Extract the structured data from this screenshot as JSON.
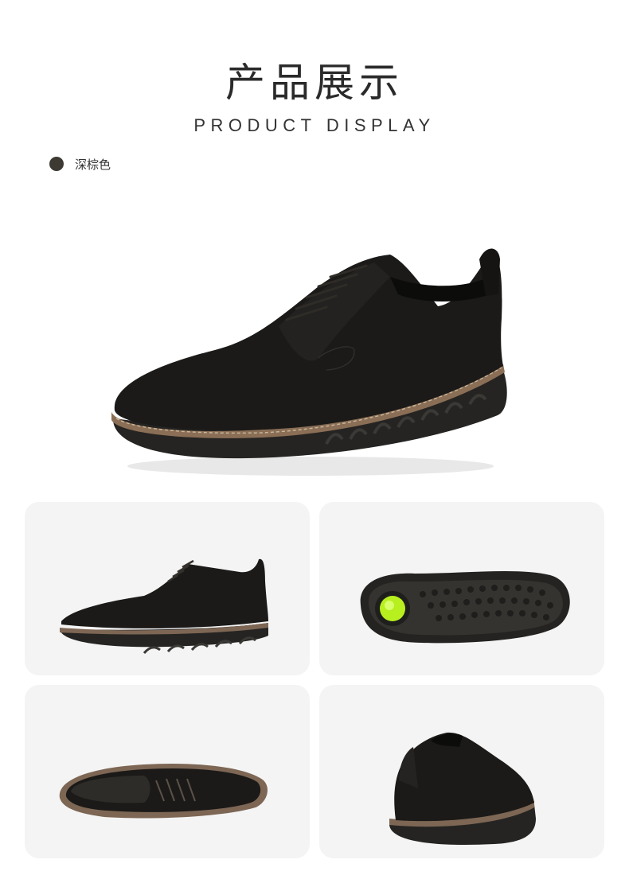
{
  "header": {
    "title_cn": "产品展示",
    "title_en": "PRODUCT DISPLAY"
  },
  "color_option": {
    "label": "深棕色",
    "swatch_color": "#3c3a33"
  },
  "colors": {
    "upper": "#1b1a18",
    "welt": "#8a6e55",
    "sole": "#252422",
    "card_bg": "#f4f4f4",
    "insert_green": "#b8ef1f"
  },
  "images": {
    "hero": "shoe-three-quarter-view",
    "side": "shoe-side-view",
    "sole": "shoe-outsole-view",
    "top": "shoe-top-view",
    "back": "shoe-back-view"
  }
}
